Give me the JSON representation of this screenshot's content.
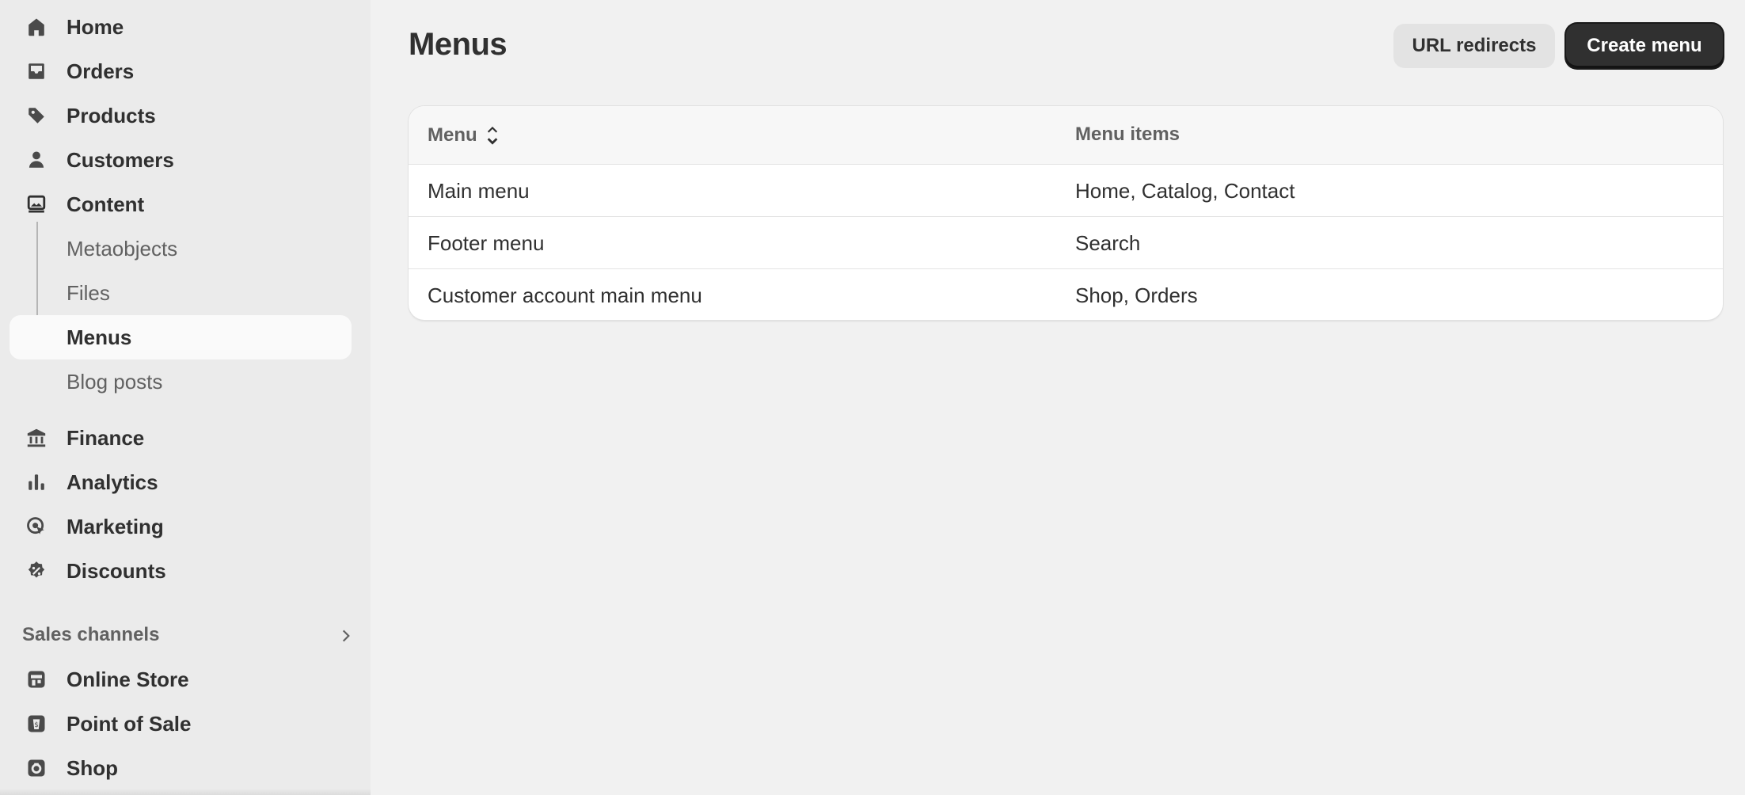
{
  "sidebar": {
    "nav": [
      {
        "label": "Home",
        "icon": "home-icon"
      },
      {
        "label": "Orders",
        "icon": "inbox-icon"
      },
      {
        "label": "Products",
        "icon": "tag-icon"
      },
      {
        "label": "Customers",
        "icon": "person-icon"
      },
      {
        "label": "Content",
        "icon": "image-icon"
      }
    ],
    "content_sub": [
      {
        "label": "Metaobjects"
      },
      {
        "label": "Files"
      },
      {
        "label": "Menus",
        "active": true
      },
      {
        "label": "Blog posts"
      }
    ],
    "nav2": [
      {
        "label": "Finance",
        "icon": "bank-icon"
      },
      {
        "label": "Analytics",
        "icon": "bar-chart-icon"
      },
      {
        "label": "Marketing",
        "icon": "target-icon"
      },
      {
        "label": "Discounts",
        "icon": "discount-icon"
      }
    ],
    "sales_channels": {
      "title": "Sales channels",
      "items": [
        {
          "label": "Online Store",
          "icon": "storefront-icon"
        },
        {
          "label": "Point of Sale",
          "icon": "pos-icon"
        },
        {
          "label": "Shop",
          "icon": "shop-icon"
        }
      ]
    }
  },
  "main": {
    "title": "Menus",
    "actions": {
      "secondary": "URL redirects",
      "primary": "Create menu"
    },
    "table": {
      "columns": [
        "Menu",
        "Menu items"
      ],
      "rows": [
        {
          "menu": "Main menu",
          "items": "Home, Catalog, Contact"
        },
        {
          "menu": "Footer menu",
          "items": "Search"
        },
        {
          "menu": "Customer account main menu",
          "items": "Shop, Orders"
        }
      ]
    }
  },
  "colors": {
    "sidebar_bg": "#ebebeb",
    "page_bg": "#f1f1f1",
    "primary_button": "#303030",
    "text": "#303030",
    "muted_text": "#616161"
  }
}
